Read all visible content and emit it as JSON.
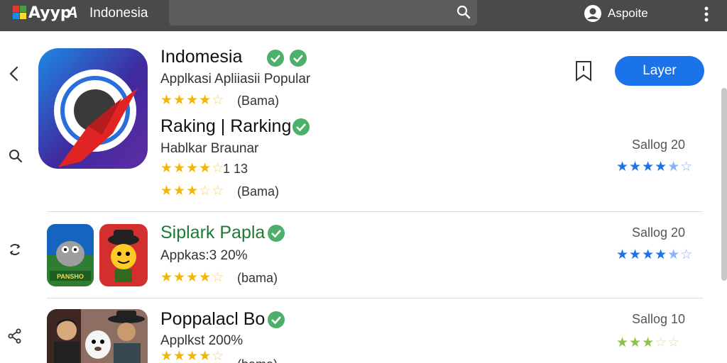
{
  "header": {
    "logo_text": "Ayyp",
    "logo_symbol": "A",
    "region": "Indonesia",
    "search_placeholder": "",
    "user_label": "Aspoite"
  },
  "featured": {
    "title": "Indomesia",
    "subtitle": "Applkasi Apliiasii Popular",
    "stars": "★★★★",
    "stars_dim": "☆",
    "meta": "(Bama)",
    "install_label": "Layer"
  },
  "ranking": {
    "title": "Raking | Rarking",
    "subtitle": "Hablkar Braunar",
    "stars1": "★★★★",
    "stars1_dim": "☆",
    "meta1": "1 13",
    "stars2": "★★★",
    "stars2_dim": "☆☆",
    "meta2": "(Bama)",
    "right_label": "Sallog 20",
    "right_stars": "★★★★",
    "right_stars_dim": "★☆"
  },
  "apps": [
    {
      "title": "Siplark Papla",
      "subtitle": "Appkas:3 20%",
      "stars": "★★★★",
      "stars_dim": "☆",
      "meta": "(bama)",
      "right_label": "Sallog 20",
      "right_stars": "★★★★",
      "right_stars_dim": "★☆",
      "badge_text": "PANSHO"
    },
    {
      "title": "Poppalacl Bo",
      "subtitle": "Applkst 200%",
      "stars": "★★★★",
      "stars_dim": "☆",
      "meta": "(bama)",
      "right_label": "Sallog 10",
      "right_stars": "★★★",
      "right_stars_dim": "☆☆"
    }
  ],
  "colors": {
    "topbar": "#4a4a4a",
    "accent": "#1a73e8",
    "verified": "#4caf6a",
    "star": "#f2b705"
  }
}
